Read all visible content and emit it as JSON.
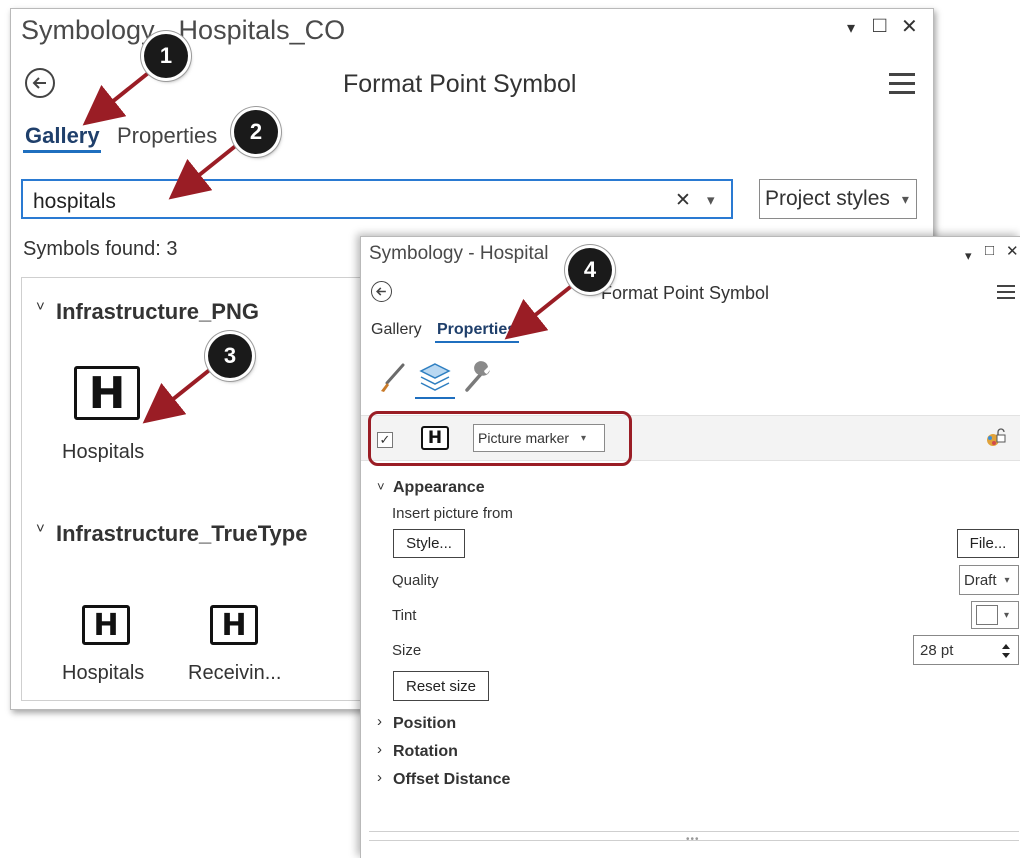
{
  "panel1": {
    "title": "Symbology - Hospitals_CO",
    "header_title": "Format Point Symbol",
    "tabs": [
      {
        "label": "Gallery",
        "active": true
      },
      {
        "label": "Properties",
        "active": false
      }
    ],
    "search": {
      "value": "hospitals",
      "clear_glyph": "✕",
      "dropdown_glyph": "▾"
    },
    "styles_dropdown": {
      "value": "Project styles",
      "glyph": "▾"
    },
    "results_text": "Symbols found: 3",
    "groups": [
      {
        "name": "Infrastructure_PNG",
        "items": [
          {
            "label": "Hospitals",
            "icon": "hospital-h-icon"
          }
        ]
      },
      {
        "name": "Infrastructure_TrueType",
        "items": [
          {
            "label": "Hospitals",
            "icon": "hospital-h-icon"
          },
          {
            "label": "Receivin...",
            "icon": "hospital-h-icon"
          }
        ]
      }
    ]
  },
  "panel2": {
    "title": "Symbology - Hospital",
    "header_title": "Format Point Symbol",
    "tabs": [
      {
        "label": "Gallery",
        "active": false
      },
      {
        "label": "Properties",
        "active": true
      }
    ],
    "icon_tabs": [
      "paintbrush-icon",
      "layers-icon",
      "wrench-icon"
    ],
    "layer_row": {
      "checkbox_glyph": "✓",
      "marker_type": "Picture marker",
      "glyph": "▾"
    },
    "sections": {
      "appearance": "Appearance",
      "position": "Position",
      "rotation": "Rotation",
      "offset": "Offset Distance"
    },
    "insert_label": "Insert picture from",
    "style_button": "Style...",
    "file_button": "File...",
    "quality_label": "Quality",
    "quality_value": "Draft",
    "tint_label": "Tint",
    "size_label": "Size",
    "size_value": "28 pt",
    "reset_button": "Reset size",
    "footer_grip": "•••"
  },
  "glyphs": {
    "h": "H",
    "chevron_down": "˅",
    "chevron_right": "›",
    "minimize": "▾",
    "maximize": "□",
    "close": "✕"
  },
  "callouts": [
    "1",
    "2",
    "3",
    "4"
  ],
  "colors": {
    "accent": "#1f6fbf",
    "callout_arrow": "#9a1d25",
    "highlight": "#9a1d25"
  }
}
